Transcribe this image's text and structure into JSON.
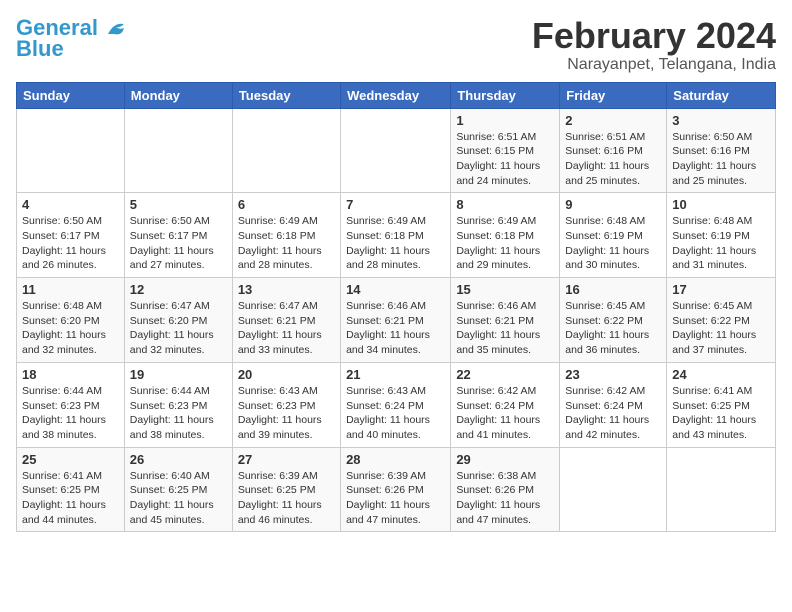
{
  "logo": {
    "part1": "General",
    "part2": "Blue"
  },
  "title": "February 2024",
  "location": "Narayanpet, Telangana, India",
  "days_of_week": [
    "Sunday",
    "Monday",
    "Tuesday",
    "Wednesday",
    "Thursday",
    "Friday",
    "Saturday"
  ],
  "weeks": [
    [
      {
        "num": "",
        "info": ""
      },
      {
        "num": "",
        "info": ""
      },
      {
        "num": "",
        "info": ""
      },
      {
        "num": "",
        "info": ""
      },
      {
        "num": "1",
        "info": "Sunrise: 6:51 AM\nSunset: 6:15 PM\nDaylight: 11 hours\nand 24 minutes."
      },
      {
        "num": "2",
        "info": "Sunrise: 6:51 AM\nSunset: 6:16 PM\nDaylight: 11 hours\nand 25 minutes."
      },
      {
        "num": "3",
        "info": "Sunrise: 6:50 AM\nSunset: 6:16 PM\nDaylight: 11 hours\nand 25 minutes."
      }
    ],
    [
      {
        "num": "4",
        "info": "Sunrise: 6:50 AM\nSunset: 6:17 PM\nDaylight: 11 hours\nand 26 minutes."
      },
      {
        "num": "5",
        "info": "Sunrise: 6:50 AM\nSunset: 6:17 PM\nDaylight: 11 hours\nand 27 minutes."
      },
      {
        "num": "6",
        "info": "Sunrise: 6:49 AM\nSunset: 6:18 PM\nDaylight: 11 hours\nand 28 minutes."
      },
      {
        "num": "7",
        "info": "Sunrise: 6:49 AM\nSunset: 6:18 PM\nDaylight: 11 hours\nand 28 minutes."
      },
      {
        "num": "8",
        "info": "Sunrise: 6:49 AM\nSunset: 6:18 PM\nDaylight: 11 hours\nand 29 minutes."
      },
      {
        "num": "9",
        "info": "Sunrise: 6:48 AM\nSunset: 6:19 PM\nDaylight: 11 hours\nand 30 minutes."
      },
      {
        "num": "10",
        "info": "Sunrise: 6:48 AM\nSunset: 6:19 PM\nDaylight: 11 hours\nand 31 minutes."
      }
    ],
    [
      {
        "num": "11",
        "info": "Sunrise: 6:48 AM\nSunset: 6:20 PM\nDaylight: 11 hours\nand 32 minutes."
      },
      {
        "num": "12",
        "info": "Sunrise: 6:47 AM\nSunset: 6:20 PM\nDaylight: 11 hours\nand 32 minutes."
      },
      {
        "num": "13",
        "info": "Sunrise: 6:47 AM\nSunset: 6:21 PM\nDaylight: 11 hours\nand 33 minutes."
      },
      {
        "num": "14",
        "info": "Sunrise: 6:46 AM\nSunset: 6:21 PM\nDaylight: 11 hours\nand 34 minutes."
      },
      {
        "num": "15",
        "info": "Sunrise: 6:46 AM\nSunset: 6:21 PM\nDaylight: 11 hours\nand 35 minutes."
      },
      {
        "num": "16",
        "info": "Sunrise: 6:45 AM\nSunset: 6:22 PM\nDaylight: 11 hours\nand 36 minutes."
      },
      {
        "num": "17",
        "info": "Sunrise: 6:45 AM\nSunset: 6:22 PM\nDaylight: 11 hours\nand 37 minutes."
      }
    ],
    [
      {
        "num": "18",
        "info": "Sunrise: 6:44 AM\nSunset: 6:23 PM\nDaylight: 11 hours\nand 38 minutes."
      },
      {
        "num": "19",
        "info": "Sunrise: 6:44 AM\nSunset: 6:23 PM\nDaylight: 11 hours\nand 38 minutes."
      },
      {
        "num": "20",
        "info": "Sunrise: 6:43 AM\nSunset: 6:23 PM\nDaylight: 11 hours\nand 39 minutes."
      },
      {
        "num": "21",
        "info": "Sunrise: 6:43 AM\nSunset: 6:24 PM\nDaylight: 11 hours\nand 40 minutes."
      },
      {
        "num": "22",
        "info": "Sunrise: 6:42 AM\nSunset: 6:24 PM\nDaylight: 11 hours\nand 41 minutes."
      },
      {
        "num": "23",
        "info": "Sunrise: 6:42 AM\nSunset: 6:24 PM\nDaylight: 11 hours\nand 42 minutes."
      },
      {
        "num": "24",
        "info": "Sunrise: 6:41 AM\nSunset: 6:25 PM\nDaylight: 11 hours\nand 43 minutes."
      }
    ],
    [
      {
        "num": "25",
        "info": "Sunrise: 6:41 AM\nSunset: 6:25 PM\nDaylight: 11 hours\nand 44 minutes."
      },
      {
        "num": "26",
        "info": "Sunrise: 6:40 AM\nSunset: 6:25 PM\nDaylight: 11 hours\nand 45 minutes."
      },
      {
        "num": "27",
        "info": "Sunrise: 6:39 AM\nSunset: 6:25 PM\nDaylight: 11 hours\nand 46 minutes."
      },
      {
        "num": "28",
        "info": "Sunrise: 6:39 AM\nSunset: 6:26 PM\nDaylight: 11 hours\nand 47 minutes."
      },
      {
        "num": "29",
        "info": "Sunrise: 6:38 AM\nSunset: 6:26 PM\nDaylight: 11 hours\nand 47 minutes."
      },
      {
        "num": "",
        "info": ""
      },
      {
        "num": "",
        "info": ""
      }
    ]
  ]
}
